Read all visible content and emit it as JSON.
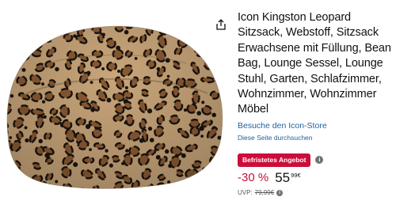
{
  "product": {
    "title": "Icon Kingston Leopard Sitzsack, Webstoff, Sitzsack Erwachsene mit Füllung, Bean Bag, Lounge Sessel, Lounge Stuhl, Garten, Schlafzimmer, Wohnzimmer, Wohnzimmer Möbel",
    "store_link": "Besuche den Icon-Store",
    "search_link": "Diese Seite durchsuchen",
    "image_icon": "leopard-bean-bag-image"
  },
  "deal": {
    "badge": "Befristetes Angebot",
    "badge_color": "#cc0c39",
    "info_glyph": "i"
  },
  "price": {
    "discount": "-30 %",
    "whole": "55",
    "fraction": "99€",
    "uvp_label": "UVP:",
    "uvp_value": "79,99€",
    "uvp_info_glyph": "i"
  },
  "icons": {
    "share": "share-icon"
  }
}
